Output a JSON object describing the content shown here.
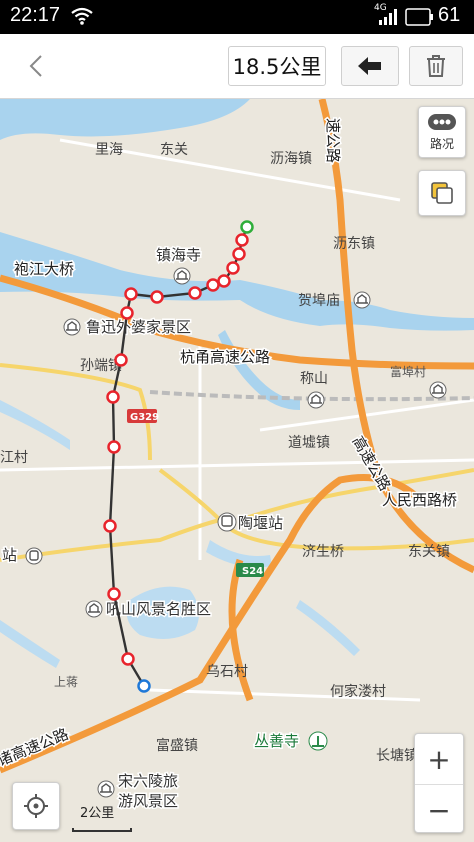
{
  "status": {
    "time": "22:17",
    "network": "4G",
    "battery": "61"
  },
  "toolbar": {
    "distance": "18.5公里"
  },
  "map": {
    "labels": {
      "lihai": "里海",
      "dongguan": "东关",
      "lihaizhen": "沥海镇",
      "lidongzhen": "沥东镇",
      "zhenhaisi": "镇海寺",
      "paojiang": "袍江大桥",
      "hefumiao": "贺埠庙",
      "luxun": "鲁迅外婆家景区",
      "sunduan": "孙端镇",
      "hangyong": "杭甬高速公路",
      "chengshan": "称山",
      "fubuchun": "富埠村",
      "daoxu": "道墟镇",
      "g329": "G329",
      "jiangcun": "江村",
      "renminxi": "人民西路桥",
      "taoyan": "陶堰站",
      "zhan": "站",
      "jishengqiao": "济生桥",
      "dongguanzhen": "东关镇",
      "s24": "S24",
      "gaosu_vertical": "高速公路",
      "yindu_vertical": "速公路",
      "tushan": "吼山风景名胜区",
      "wushi": "乌石村",
      "shangzhu": "上蒋",
      "hejialou": "何家溇村",
      "congshansi": "丛善寺",
      "zhugao": "诸高速公路",
      "fusheng": "富盛镇",
      "changtang": "长塘镇",
      "songliuling": "宋六陵旅",
      "songliuling2": "游风景区"
    },
    "traffic_label": "路况",
    "scale_label": "2公里",
    "zoom_in": "+",
    "zoom_out": "−",
    "route_color": "#e8242c",
    "highway_color": "#f39a3b"
  }
}
